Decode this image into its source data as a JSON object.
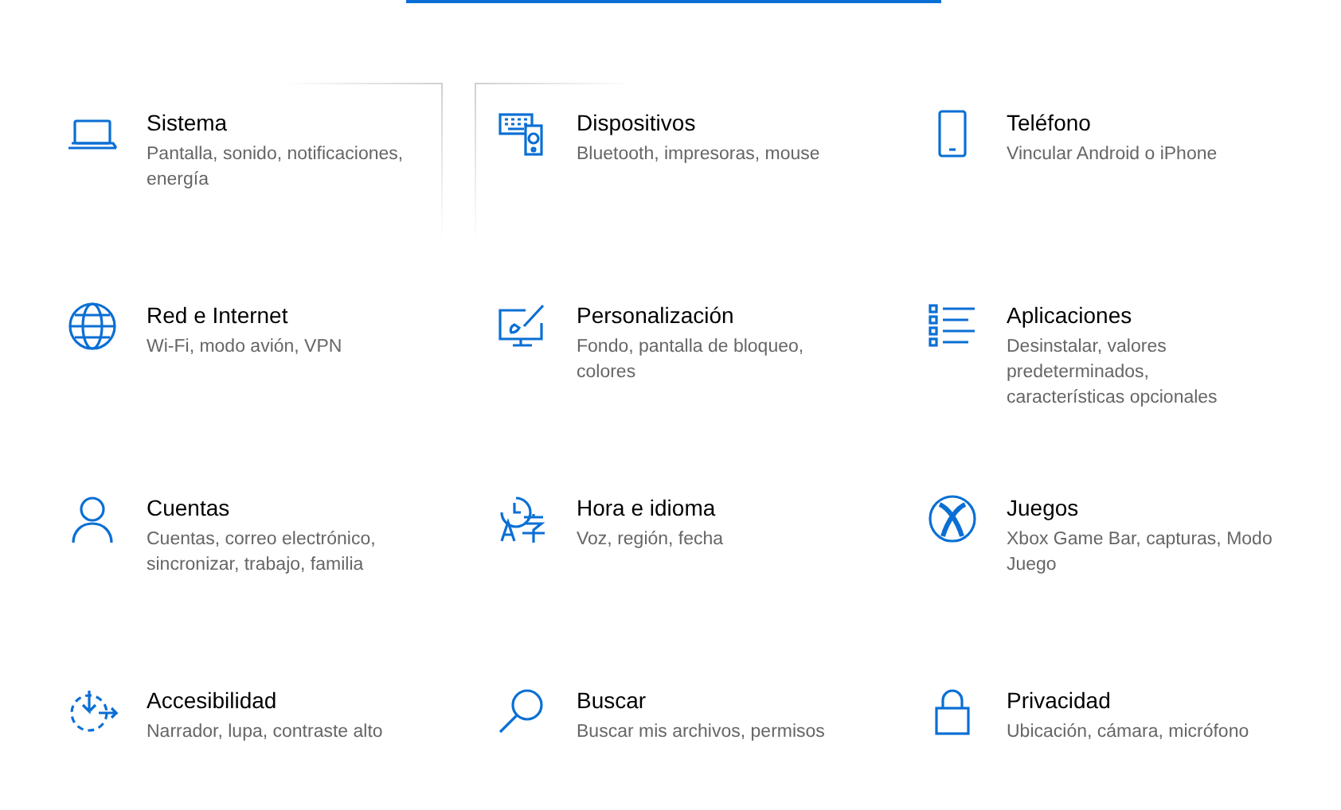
{
  "tiles": [
    {
      "title": "Sistema",
      "desc": "Pantalla, sonido, notificaciones,\nenergía",
      "highlighted": true
    },
    {
      "title": "Dispositivos",
      "desc": "Bluetooth, impresoras, mouse",
      "highlighted": true
    },
    {
      "title": "Teléfono",
      "desc": "Vincular Android o iPhone",
      "highlighted": false
    },
    {
      "title": "Red e Internet",
      "desc": "Wi-Fi, modo avión, VPN",
      "highlighted": false
    },
    {
      "title": "Personalización",
      "desc": "Fondo, pantalla de bloqueo,\ncolores",
      "highlighted": false
    },
    {
      "title": "Aplicaciones",
      "desc": "Desinstalar, valores\npredeterminados,\ncaracterísticas opcionales",
      "highlighted": false
    },
    {
      "title": "Cuentas",
      "desc": "Cuentas, correo electrónico,\nsincronizar, trabajo, familia",
      "highlighted": false
    },
    {
      "title": "Hora e idioma",
      "desc": "Voz, región, fecha",
      "highlighted": false
    },
    {
      "title": "Juegos",
      "desc": "Xbox Game Bar, capturas, Modo\nJuego",
      "highlighted": false
    },
    {
      "title": "Accesibilidad",
      "desc": "Narrador, lupa, contraste alto",
      "highlighted": false
    },
    {
      "title": "Buscar",
      "desc": "Buscar mis archivos, permisos",
      "highlighted": false
    },
    {
      "title": "Privacidad",
      "desc": "Ubicación, cámara, micrófono",
      "highlighted": false
    }
  ]
}
